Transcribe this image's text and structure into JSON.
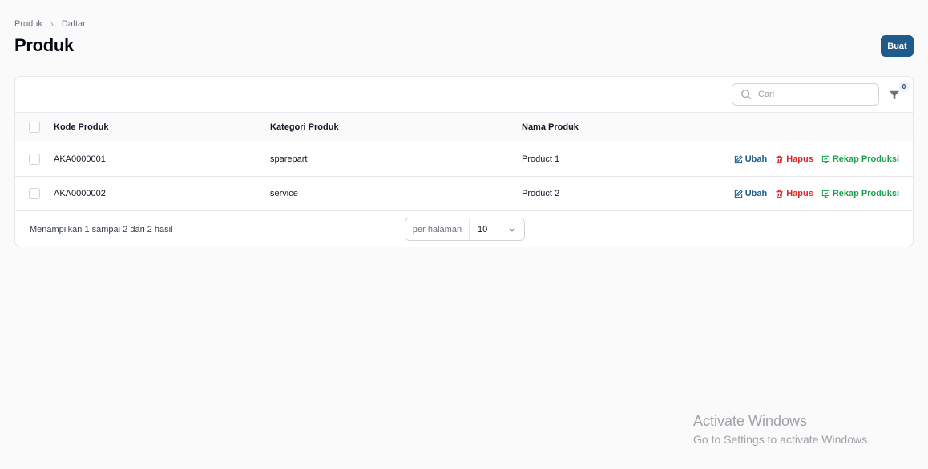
{
  "breadcrumb": {
    "items": [
      "Produk",
      "Daftar"
    ],
    "separator": "›"
  },
  "header": {
    "title": "Produk",
    "create_label": "Buat"
  },
  "toolbar": {
    "search_placeholder": "Cari",
    "filter_count": "0"
  },
  "table": {
    "columns": [
      "Kode Produk",
      "Kategori Produk",
      "Nama Produk"
    ],
    "rows": [
      {
        "kode": "AKA0000001",
        "kategori": "sparepart",
        "nama": "Product 1"
      },
      {
        "kode": "AKA0000002",
        "kategori": "service",
        "nama": "Product 2"
      }
    ],
    "actions": {
      "edit": "Ubah",
      "delete": "Hapus",
      "recap": "Rekap Produksi"
    }
  },
  "footer": {
    "info": "Menampilkan 1 sampai 2 dari 2 hasil",
    "per_page_label": "per halaman",
    "per_page_value": "10"
  },
  "watermark": {
    "line1": "Activate Windows",
    "line2": "Go to Settings to activate Windows."
  },
  "colors": {
    "primary": "#1e5b8a",
    "danger": "#dc2626",
    "success": "#16a34a"
  }
}
